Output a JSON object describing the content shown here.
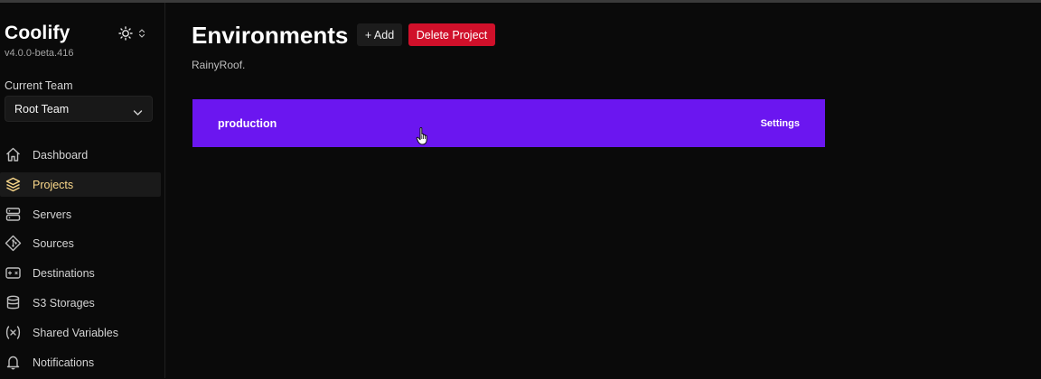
{
  "app": {
    "name": "Coolify",
    "version": "v4.0.0-beta.416"
  },
  "sidebar": {
    "team_label": "Current Team",
    "team_value": "Root Team",
    "items": [
      {
        "label": "Dashboard",
        "icon": "home-icon",
        "active": false
      },
      {
        "label": "Projects",
        "icon": "layers-icon",
        "active": true
      },
      {
        "label": "Servers",
        "icon": "server-icon",
        "active": false
      },
      {
        "label": "Sources",
        "icon": "git-icon",
        "active": false
      },
      {
        "label": "Destinations",
        "icon": "destination-icon",
        "active": false
      },
      {
        "label": "S3 Storages",
        "icon": "database-icon",
        "active": false
      },
      {
        "label": "Shared Variables",
        "icon": "variable-icon",
        "active": false
      },
      {
        "label": "Notifications",
        "icon": "bell-icon",
        "active": false
      }
    ]
  },
  "main": {
    "title": "Environments",
    "add_label": "+ Add",
    "delete_label": "Delete Project",
    "project_name": "RainyRoof.",
    "environments": [
      {
        "name": "production",
        "settings_label": "Settings"
      }
    ]
  },
  "colors": {
    "background": "#0a0a0a",
    "active_nav": "#fcd98b",
    "env_card": "#6b16f0",
    "danger": "#d0102a"
  }
}
